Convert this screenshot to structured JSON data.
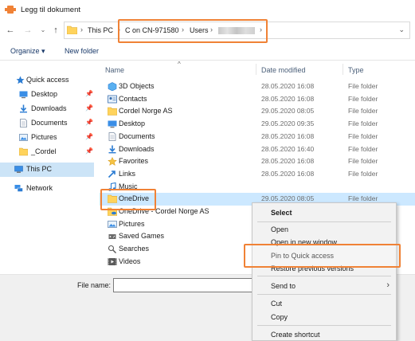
{
  "window": {
    "title": "Legg til dokument"
  },
  "address": {
    "crumbs": [
      "This PC",
      "C on CN-971580",
      "Users"
    ],
    "sep": "›"
  },
  "toolbar": {
    "organize_label": "Organize",
    "organize_caret": "▾",
    "new_folder_label": "New folder"
  },
  "nav": {
    "items": [
      {
        "label": "Quick access"
      },
      {
        "label": "Desktop",
        "pin": "📌"
      },
      {
        "label": "Downloads",
        "pin": "📌"
      },
      {
        "label": "Documents",
        "pin": "📌"
      },
      {
        "label": "Pictures",
        "pin": "📌"
      },
      {
        "label": "_Cordel",
        "pin": "📌"
      },
      {
        "label": "This PC"
      },
      {
        "label": "Network"
      }
    ]
  },
  "columns": {
    "name": "Name",
    "date": "Date modified",
    "type": "Type"
  },
  "files": [
    {
      "name": "3D Objects",
      "date": "28.05.2020 16:08",
      "type": "File folder"
    },
    {
      "name": "Contacts",
      "date": "28.05.2020 16:08",
      "type": "File folder"
    },
    {
      "name": "Cordel Norge AS",
      "date": "29.05.2020 08:05",
      "type": "File folder"
    },
    {
      "name": "Desktop",
      "date": "29.05.2020 09:35",
      "type": "File folder"
    },
    {
      "name": "Documents",
      "date": "28.05.2020 16:08",
      "type": "File folder"
    },
    {
      "name": "Downloads",
      "date": "28.05.2020 16:40",
      "type": "File folder"
    },
    {
      "name": "Favorites",
      "date": "28.05.2020 16:08",
      "type": "File folder"
    },
    {
      "name": "Links",
      "date": "28.05.2020 16:08",
      "type": "File folder"
    },
    {
      "name": "Music",
      "date": "",
      "type": ""
    },
    {
      "name": "OneDrive",
      "date": "29.05.2020 08:05",
      "type": "File folder"
    },
    {
      "name": "OneDrive - Cordel Norge AS",
      "date": "",
      "type": ""
    },
    {
      "name": "Pictures",
      "date": "",
      "type": ""
    },
    {
      "name": "Saved Games",
      "date": "",
      "type": ""
    },
    {
      "name": "Searches",
      "date": "",
      "type": ""
    },
    {
      "name": "Videos",
      "date": "",
      "type": ""
    }
  ],
  "filename": {
    "label": "File name:",
    "value": ""
  },
  "context_menu": {
    "items": [
      "Select",
      "Open",
      "Open in new window",
      "Pin to Quick access",
      "Restore previous versions",
      "Send to",
      "Cut",
      "Copy",
      "Create shortcut"
    ],
    "submenu_arrow": "›"
  },
  "colors": {
    "highlight_orange": "#f08236",
    "selection_blue": "#cce8ff",
    "folder_yellow": "#ffd35c"
  }
}
